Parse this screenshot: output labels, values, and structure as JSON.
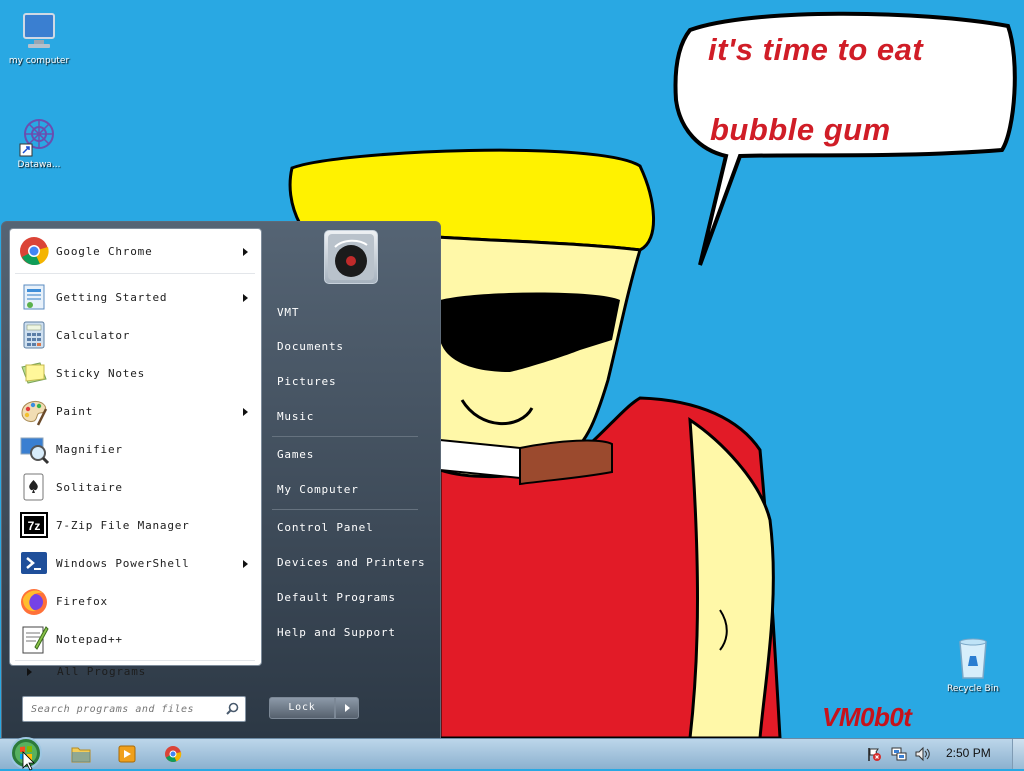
{
  "desktop": {
    "icons": [
      {
        "label": "my computer"
      },
      {
        "label": "Datawa..."
      },
      {
        "label": "Recycle Bin"
      }
    ],
    "wallpaper": {
      "caption_line1": "it's time to eat",
      "caption_line2": "bubble gum",
      "watermark": "VM0b0t"
    }
  },
  "start_menu": {
    "programs": [
      {
        "label": "Google Chrome",
        "submenu": true,
        "icon": "chrome-icon"
      },
      {
        "label": "Getting Started",
        "submenu": true,
        "icon": "getting-started-icon"
      },
      {
        "label": "Calculator",
        "submenu": false,
        "icon": "calculator-icon"
      },
      {
        "label": "Sticky Notes",
        "submenu": false,
        "icon": "sticky-notes-icon"
      },
      {
        "label": "Paint",
        "submenu": true,
        "icon": "paint-icon"
      },
      {
        "label": "Magnifier",
        "submenu": false,
        "icon": "magnifier-icon"
      },
      {
        "label": "Solitaire",
        "submenu": false,
        "icon": "solitaire-icon"
      },
      {
        "label": "7-Zip File Manager",
        "submenu": false,
        "icon": "7zip-icon"
      },
      {
        "label": "Windows PowerShell",
        "submenu": true,
        "icon": "powershell-icon"
      },
      {
        "label": "Firefox",
        "submenu": false,
        "icon": "firefox-icon"
      },
      {
        "label": "Notepad++",
        "submenu": false,
        "icon": "notepadpp-icon"
      }
    ],
    "all_programs": "All Programs",
    "search_placeholder": "Search programs and files",
    "right_items": [
      "VMT",
      "Documents",
      "Pictures",
      "Music",
      "Games",
      "My Computer",
      "Control Panel",
      "Devices and Printers",
      "Default Programs",
      "Help and Support"
    ],
    "lock_label": "Lock"
  },
  "taskbar": {
    "clock": "2:50 PM"
  }
}
